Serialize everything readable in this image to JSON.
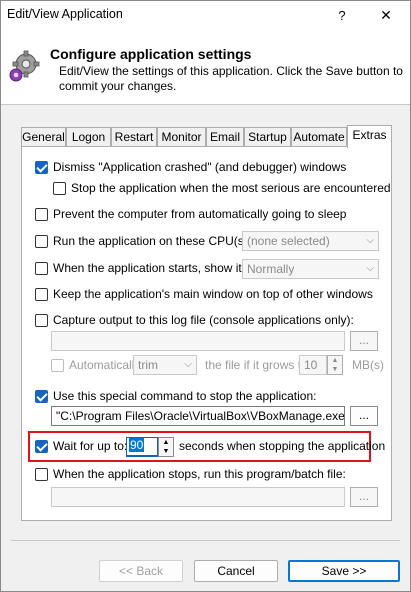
{
  "window": {
    "title": "Edit/View Application",
    "help_label": "?",
    "close_label": "✕"
  },
  "header": {
    "title": "Configure application settings",
    "description": "Edit/View the settings of this application. Click the Save button to commit your changes.",
    "icon": "gear-icon"
  },
  "tabs": [
    {
      "label": "General"
    },
    {
      "label": "Logon"
    },
    {
      "label": "Restart"
    },
    {
      "label": "Monitor"
    },
    {
      "label": "Email"
    },
    {
      "label": "Startup"
    },
    {
      "label": "Automate"
    },
    {
      "label": "Extras",
      "active": true
    }
  ],
  "options": {
    "dismiss_crash": {
      "label": "Dismiss \"Application crashed\" (and debugger) windows",
      "checked": true
    },
    "stop_on_serious": {
      "label": "Stop the application when the most serious are encountered",
      "checked": false
    },
    "prevent_sleep": {
      "label": "Prevent the computer from automatically going to sleep",
      "checked": false
    },
    "run_on_cpus": {
      "label": "Run the application on these CPU(s):",
      "checked": false,
      "value": "(none selected)"
    },
    "show_it": {
      "label": "When the application starts, show it:",
      "checked": false,
      "value": "Normally"
    },
    "keep_on_top": {
      "label": "Keep the application's main window on top of other windows",
      "checked": false
    },
    "capture_output": {
      "label": "Capture output to this log file (console applications only):",
      "checked": false,
      "browse": "..."
    },
    "auto_trim": {
      "label": "Automatically",
      "checked": false,
      "mode": "trim",
      "condition": "the file if it grows to",
      "size": "10",
      "unit": "MB(s)"
    },
    "special_stop": {
      "label": "Use this special command to stop the application:",
      "checked": true,
      "command": "\"C:\\Program Files\\Oracle\\VirtualBox\\VBoxManage.exe\" cont",
      "browse": "..."
    },
    "wait_for": {
      "label": "Wait for up to:",
      "checked": true,
      "value": "90",
      "suffix": "seconds when stopping the application"
    },
    "run_on_stop": {
      "label": "When the application stops, run this program/batch file:",
      "checked": false,
      "browse": "..."
    }
  },
  "buttons": {
    "back": "<< Back",
    "cancel": "Cancel",
    "save": "Save >>"
  },
  "colors": {
    "accent": "#1565c0",
    "highlight": "#e0121c"
  }
}
